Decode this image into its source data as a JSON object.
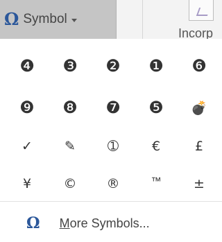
{
  "ribbon": {
    "symbol_button": {
      "icon": "omega-icon",
      "icon_glyph": "Ω",
      "label": "Symbol"
    },
    "neighbor_label": "Incorp"
  },
  "symbols": [
    [
      "❹",
      "❸",
      "❷",
      "❶",
      "❻"
    ],
    [
      "❾",
      "❽",
      "❼",
      "❺",
      "💣"
    ],
    [
      "✓",
      "✎",
      "➀",
      "€",
      "£"
    ],
    [
      "¥",
      "©",
      "®",
      "™",
      "±"
    ]
  ],
  "more_symbols": {
    "icon_glyph": "Ω",
    "access_key": "M",
    "label_rest": "ore Symbols..."
  },
  "colors": {
    "accent": "#2b579a",
    "button_bg": "#c5c5c5"
  }
}
